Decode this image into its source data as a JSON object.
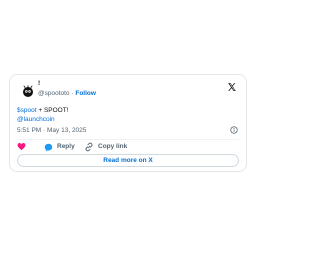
{
  "tweet": {
    "author": {
      "display_name": "!",
      "handle": "@spoototo",
      "separator": "·",
      "follow_label": "Follow"
    },
    "text": {
      "cashtag": "$spoot",
      "main": " + SPOOT!",
      "mention": "@launchcoin"
    },
    "meta": {
      "time": "5:51 PM",
      "separator": "·",
      "date": "May 13, 2025"
    },
    "actions": {
      "reply_label": "Reply",
      "copy_link_label": "Copy link"
    },
    "read_more_label": "Read more on X"
  },
  "colors": {
    "accent": "#006fd6",
    "like": "#f91880",
    "muted": "#536471",
    "text": "#0f1419"
  },
  "icons": {
    "brand": "x-logo-icon",
    "avatar": "avatar",
    "info": "info-icon",
    "like": "heart-icon",
    "reply": "speech-bubble-icon",
    "copy": "link-icon"
  }
}
